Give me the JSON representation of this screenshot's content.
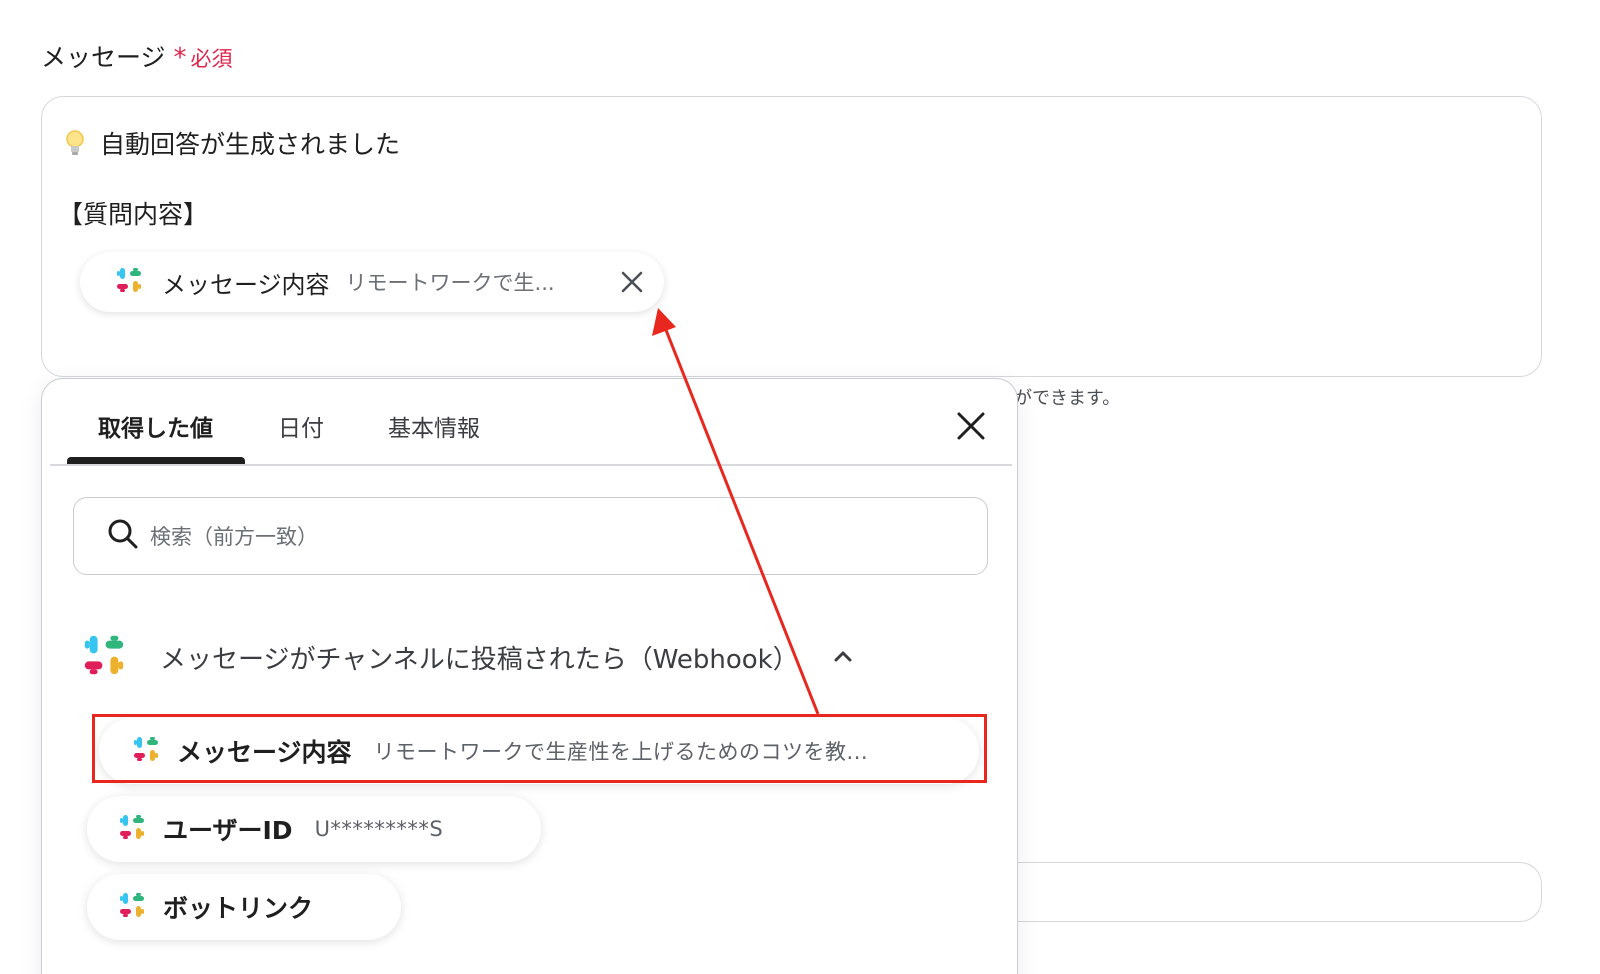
{
  "field": {
    "label": "メッセージ",
    "required_star": "*",
    "required_text": "必須"
  },
  "message_box": {
    "line1": "自動回答が生成されました",
    "line2": "【質問内容】",
    "token": {
      "name": "メッセージ内容",
      "value": "リモートワークで生..."
    }
  },
  "hint": "ができます。",
  "popup": {
    "tabs": [
      "取得した値",
      "日付",
      "基本情報"
    ],
    "active_tab": 0,
    "search": {
      "placeholder": "検索（前方一致）"
    },
    "group": {
      "title": "メッセージがチャンネルに投稿されたら（Webhook）"
    },
    "items": [
      {
        "name": "メッセージ内容",
        "value": "リモートワークで生産性を上げるためのコツを教..."
      },
      {
        "name": "ユーザーID",
        "value": "U*********S"
      },
      {
        "name": "ボットリンク",
        "value": ""
      }
    ]
  },
  "colors": {
    "required": "#e0244a",
    "highlight": "#e8281f",
    "arrow": "#e8281f"
  },
  "icons": [
    "lightbulb-icon",
    "slack-icon",
    "close-icon",
    "search-icon",
    "chevron-up-icon"
  ]
}
